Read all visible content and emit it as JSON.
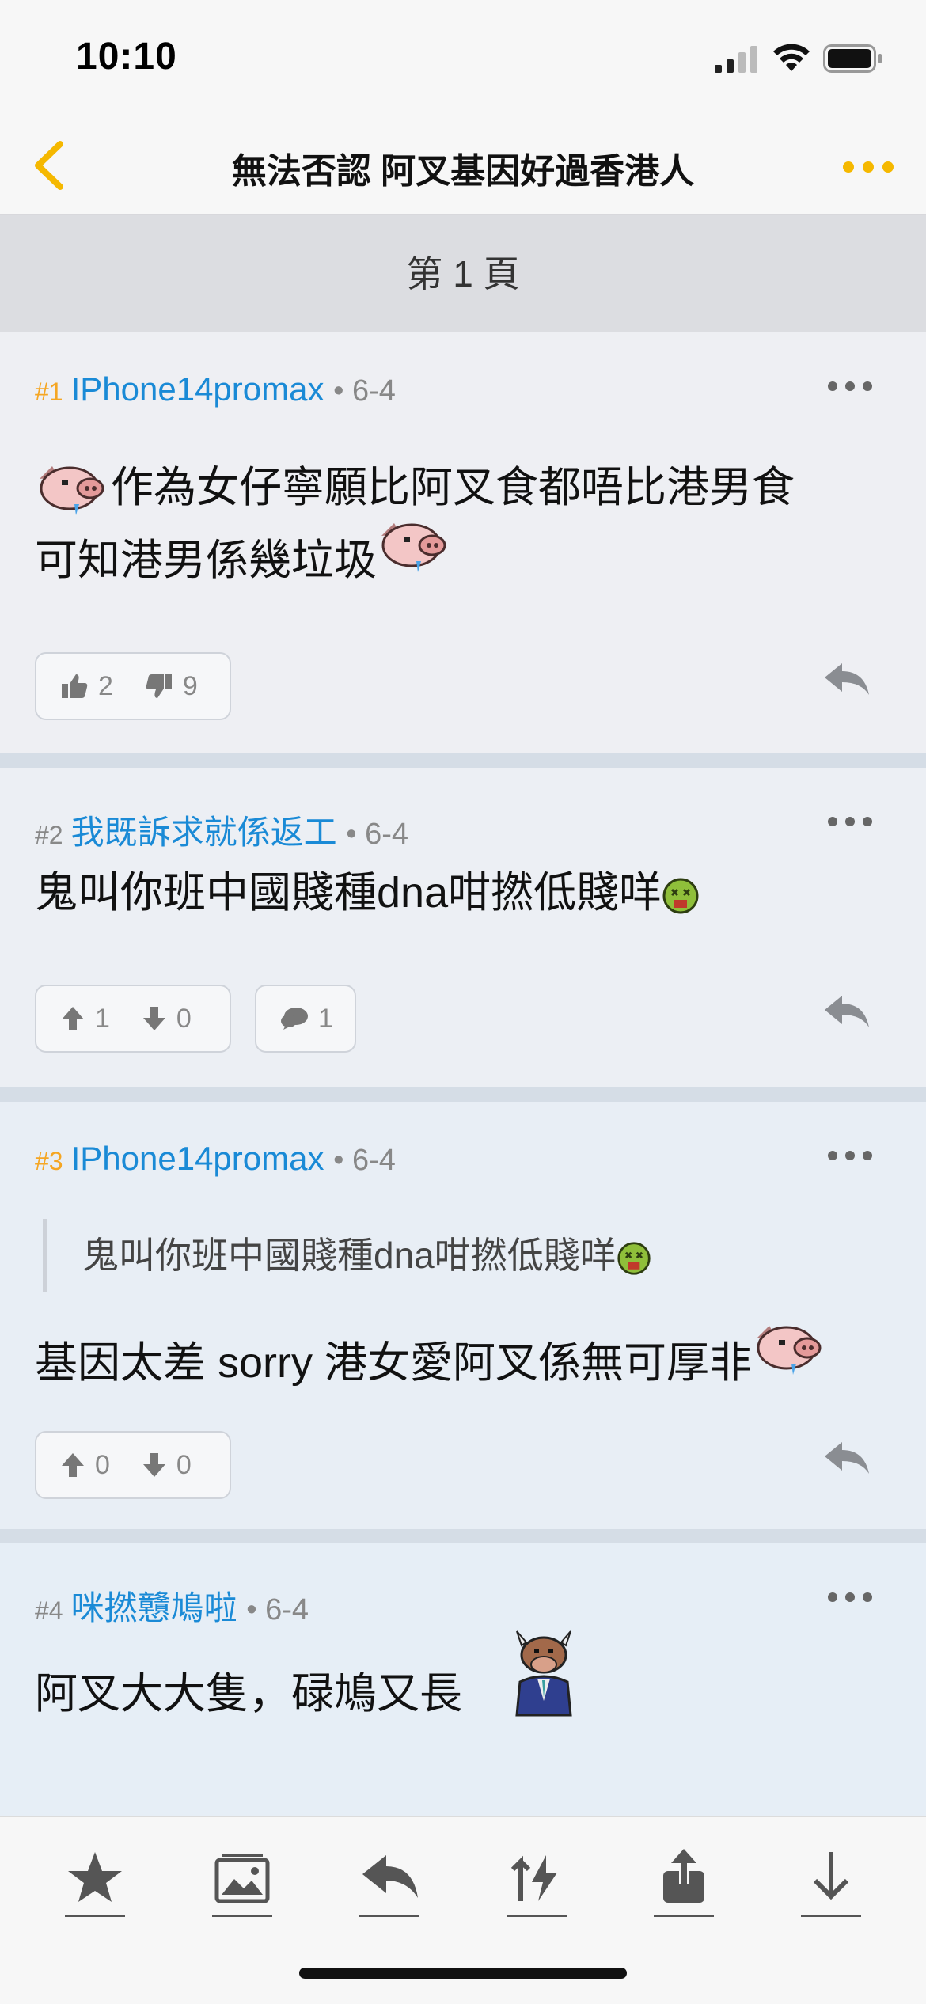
{
  "status": {
    "time": "10:10"
  },
  "nav": {
    "title": "無法否認 阿叉基因好過香港人"
  },
  "page_header": "第 1 頁",
  "posts": [
    {
      "num": "#1",
      "user": "IPhone14promax",
      "date": "• 6-4",
      "line1": "作為女仔寧願比阿叉食都唔比港男食",
      "line2": "可知港男係幾垃圾",
      "likes": "2",
      "dislikes": "9"
    },
    {
      "num": "#2",
      "user": "我既訴求就係返工",
      "date": "• 6-4",
      "text": "鬼叫你班中國賤種dna咁撚低賤咩",
      "up": "1",
      "down": "0",
      "comments": "1"
    },
    {
      "num": "#3",
      "user": "IPhone14promax",
      "date": "• 6-4",
      "quote": "鬼叫你班中國賤種dna咁撚低賤咩",
      "text": "基因太差 sorry 港女愛阿叉係無可厚非",
      "up": "0",
      "down": "0"
    },
    {
      "num": "#4",
      "user": "咪撚戇鳩啦",
      "date": "• 6-4",
      "text": "阿叉大大隻，碌鳩又長"
    }
  ],
  "colors": {
    "accent": "#f5b800",
    "username": "#1a8ad6",
    "post_number_op": "#f5a623"
  },
  "icons": {
    "toolbar": [
      "star-icon",
      "gallery-icon",
      "reply-icon",
      "sort-icon",
      "share-icon",
      "download-icon"
    ]
  }
}
